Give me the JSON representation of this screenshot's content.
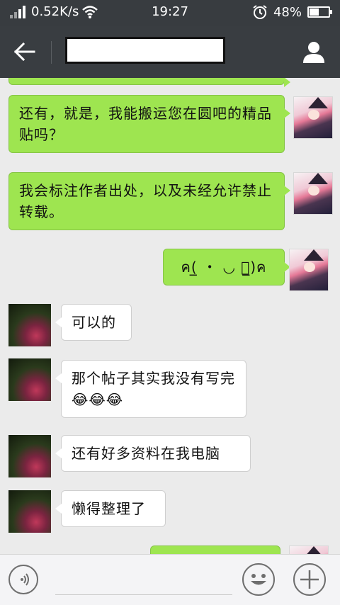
{
  "status_bar": {
    "net_speed": "0.52K/s",
    "time": "19:27",
    "battery": "48%",
    "battery_level": 0.48,
    "icons": [
      "signal-icon",
      "wifi-icon",
      "alarm-icon",
      "battery-icon"
    ]
  },
  "nav": {
    "back_icon": "back-arrow-icon",
    "contact_name": "",
    "profile_icon": "person-icon"
  },
  "messages": [
    {
      "from": "me",
      "text": "还有，就是，我能搬运您在圆吧的精品贴吗？"
    },
    {
      "from": "me",
      "text": "我会标注作者出处，以及未经允许禁止转载。"
    },
    {
      "from": "me",
      "text": "ค(̲ ・ ◡ ・̲)ค"
    },
    {
      "from": "other",
      "text": "可以的"
    },
    {
      "from": "other",
      "text": "那个帖子其实我没有写完😂😂😂"
    },
    {
      "from": "other",
      "text": "还有好多资料在我电脑"
    },
    {
      "from": "other",
      "text": "懒得整理了"
    },
    {
      "from": "me",
      "text": ""
    }
  ],
  "input_bar": {
    "voice_icon": "voice-icon",
    "emoji_icon": "emoji-icon",
    "plus_icon": "plus-icon"
  },
  "colors": {
    "bar": "#393d41",
    "out_bubble": "#9ee550",
    "in_bubble": "#ffffff",
    "background": "#ebebeb"
  }
}
